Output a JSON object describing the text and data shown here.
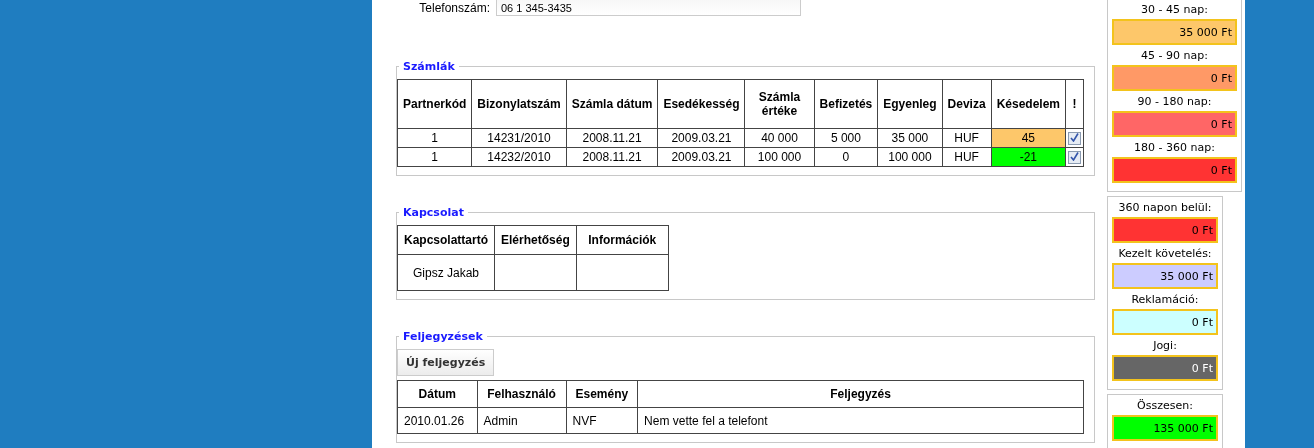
{
  "phone": {
    "label": "Telefonszám:",
    "value": "06 1 345-3435"
  },
  "invoices": {
    "legend": "Számlák",
    "columns": [
      "Partnerkód",
      "Bizonylatszám",
      "Számla dátum",
      "Esedékesség",
      "Számla értéke",
      "Befizetés",
      "Egyenleg",
      "Deviza",
      "Késedelem",
      "!"
    ],
    "rows": [
      {
        "cells": [
          "1",
          "14231/2010",
          "2008.11.21",
          "2009.03.21",
          "40 000",
          "5 000",
          "35 000",
          "HUF"
        ],
        "delay": "45",
        "color": "#fdc76a",
        "checked": true
      },
      {
        "cells": [
          "1",
          "14232/2010",
          "2008.11.21",
          "2009.03.21",
          "100 000",
          "0",
          "100 000",
          "HUF"
        ],
        "delay": "-21",
        "color": "#00ff00",
        "checked": true
      }
    ]
  },
  "contacts": {
    "legend": "Kapcsolat",
    "columns": [
      "Kapcsolattartó",
      "Elérhetőség",
      "Információk"
    ],
    "rows": [
      [
        "Gipsz Jakab",
        "",
        ""
      ]
    ]
  },
  "notes": {
    "legend": "Feljegyzések",
    "button": "Új feljegyzés",
    "columns": [
      "Dátum",
      "Felhasználó",
      "Esemény",
      "Feljegyzés"
    ],
    "rows": [
      [
        "2010.01.26",
        "Admin",
        "NVF",
        "Nem vette fel a telefont"
      ]
    ]
  },
  "summary": [
    {
      "items": [
        {
          "label": "30 - 45 nap:",
          "value": "35 000 Ft",
          "color": "#fdc76a"
        },
        {
          "label": "45 - 90 nap:",
          "value": "0 Ft",
          "color": "#ff9966"
        },
        {
          "label": "90 - 180 nap:",
          "value": "0 Ft",
          "color": "#ff6666"
        },
        {
          "label": "180 - 360 nap:",
          "value": "0 Ft",
          "color": "#ff3333"
        }
      ]
    },
    {
      "items": [
        {
          "label": "360 napon belül:",
          "value": "0 Ft",
          "color": "#ff3333"
        },
        {
          "label": "Kezelt követelés:",
          "value": "35 000 Ft",
          "color": "#ccccff"
        },
        {
          "label": "Reklamáció:",
          "value": "0 Ft",
          "color": "#ccffff"
        },
        {
          "label": "Jogi:",
          "value": "0 Ft",
          "color": "#666666"
        }
      ]
    },
    {
      "items": [
        {
          "label": "Összesen:",
          "value": "135 000 Ft",
          "color": "#00ff00"
        }
      ]
    }
  ]
}
